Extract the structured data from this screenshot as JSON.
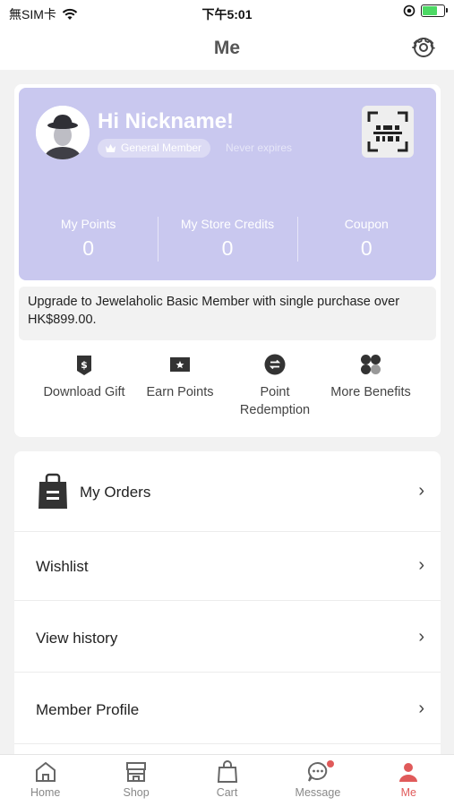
{
  "status_bar": {
    "carrier": "無SIM卡",
    "time": "下午5:01"
  },
  "header": {
    "title": "Me"
  },
  "member_card": {
    "greeting": "Hi Nickname!",
    "tier": "General Member",
    "expiry": "Never expires",
    "stats": [
      {
        "label": "My Points",
        "value": "0"
      },
      {
        "label": "My Store Credits",
        "value": "0"
      },
      {
        "label": "Coupon",
        "value": "0"
      }
    ]
  },
  "upgrade_notice": "Upgrade to Jewelaholic Basic Member with single purchase over HK$899.00.",
  "quick_actions": [
    {
      "label": "Download Gift",
      "icon": "gift-tag-icon"
    },
    {
      "label": "Earn Points",
      "icon": "ticket-icon"
    },
    {
      "label": "Point Redemption",
      "icon": "exchange-icon"
    },
    {
      "label": "More Benefits",
      "icon": "grid-icon"
    }
  ],
  "menu": {
    "orders": "My Orders",
    "wishlist": "Wishlist",
    "history": "View history",
    "profile": "Member Profile"
  },
  "tabs": [
    {
      "label": "Home",
      "icon": "home-icon"
    },
    {
      "label": "Shop",
      "icon": "shop-icon"
    },
    {
      "label": "Cart",
      "icon": "cart-icon"
    },
    {
      "label": "Message",
      "icon": "message-icon"
    },
    {
      "label": "Me",
      "icon": "person-icon",
      "active": true
    }
  ],
  "colors": {
    "card": "#c9c8ef",
    "accent": "#e05a5a",
    "background": "#f2f2f2"
  }
}
